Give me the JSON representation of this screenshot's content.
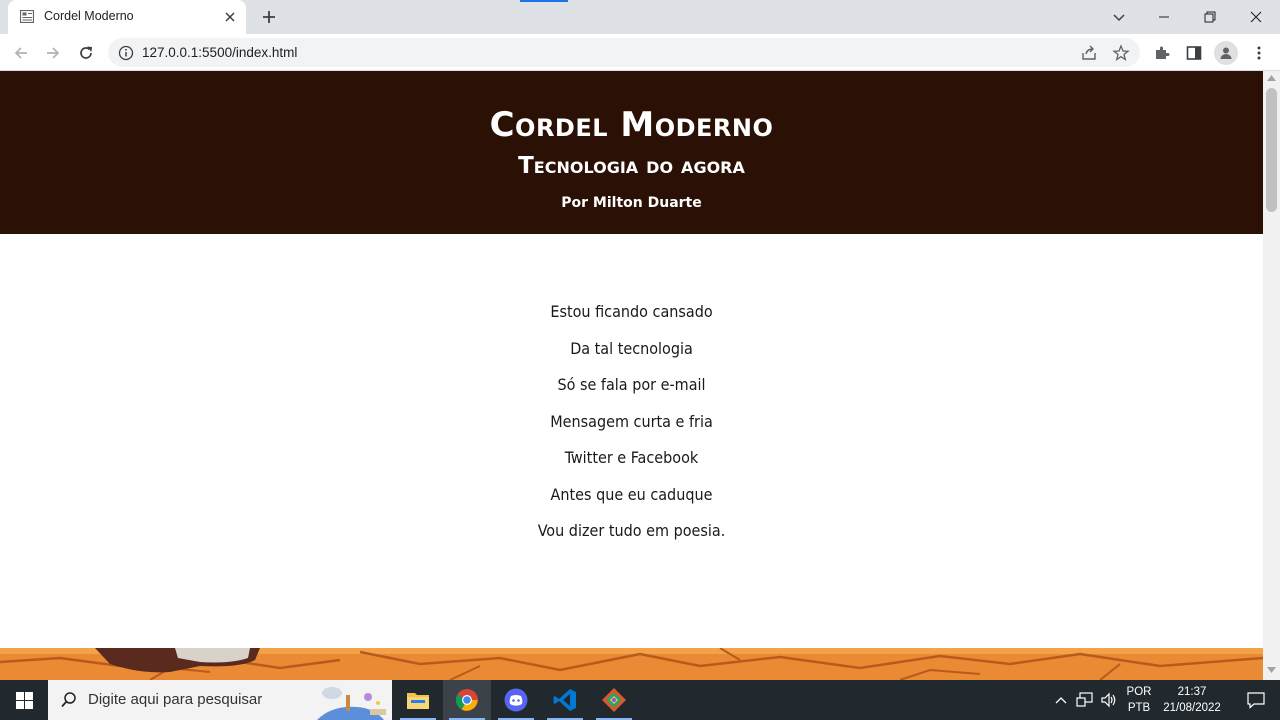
{
  "browser": {
    "tab_title": "Cordel Moderno",
    "url": "127.0.0.1:5500/index.html"
  },
  "page": {
    "title": "Cordel Moderno",
    "subtitle": "Tecnologia do agora",
    "author": "Por Milton Duarte",
    "header_bg": "#2a1005",
    "poem": [
      "Estou ficando cansado",
      "Da tal tecnologia",
      "Só se fala por e-mail",
      "Mensagem curta e fria",
      "Twitter e Facebook",
      "Antes que eu caduque",
      "Vou dizer tudo em poesia."
    ]
  },
  "taskbar": {
    "search_placeholder": "Digite aqui para pesquisar",
    "lang_line1": "POR",
    "lang_line2": "PTB",
    "time": "21:37",
    "date": "21/08/2022",
    "apps": [
      "file-explorer",
      "chrome",
      "discord",
      "vscode",
      "git-kraken"
    ]
  }
}
